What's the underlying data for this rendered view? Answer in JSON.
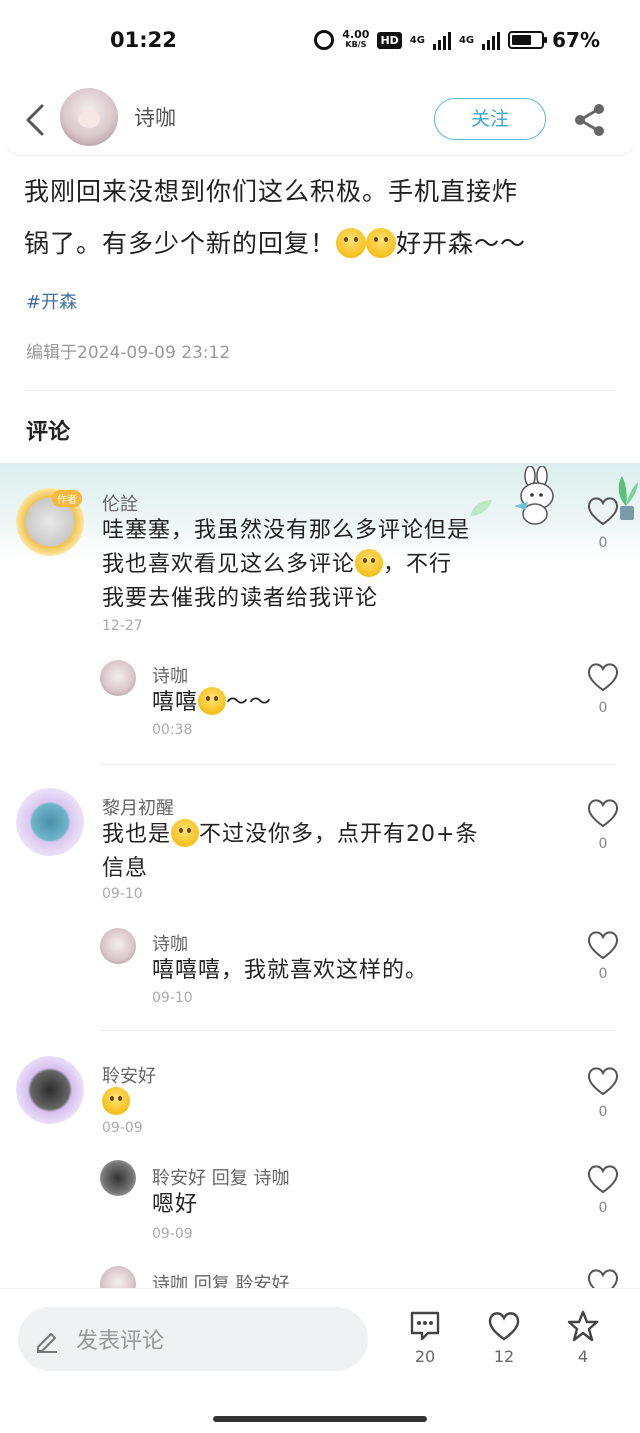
{
  "status_bar": {
    "time": "01:22",
    "net_speed_value": "4.00",
    "net_speed_unit": "KB/S",
    "hd_label": "HD",
    "signal1_label": "4G",
    "signal2_label": "4G",
    "battery_percent": "67%",
    "battery_level": 0.67
  },
  "header": {
    "author_name": "诗咖",
    "follow_label": "关注"
  },
  "post": {
    "text_line1": "我刚回来没想到你们这么积极。手机直接炸",
    "text_line2_a": "锅了。有多少个新的回复！",
    "text_line2_b": "好开森～～",
    "hashtag": "#开森",
    "edit_time": "编辑于2024-09-09 23:12"
  },
  "comments_section": {
    "title": "评论"
  },
  "comments": [
    {
      "name": "伦詮",
      "badge": "作者",
      "line1": "哇塞塞，我虽然没有那么多评论但是",
      "line2a": "我也喜欢看见这么多评论",
      "line2b": "，不行",
      "line3": "我要去催我的读者给我评论",
      "time": "12-27",
      "likes": "0",
      "reply": {
        "name": "诗咖",
        "text_a": "嘻嘻",
        "text_b": "～～",
        "time": "00:38",
        "likes": "0"
      }
    },
    {
      "name": "黎月初醒",
      "line1a": "我也是",
      "line1b": "不过没你多，点开有20+条",
      "line2": "信息",
      "time": "09-10",
      "likes": "0",
      "reply": {
        "name": "诗咖",
        "text": "嘻嘻嘻，我就喜欢这样的。",
        "time": "09-10",
        "likes": "0"
      }
    },
    {
      "name": "聆安好",
      "time": "09-09",
      "likes": "0",
      "reply": {
        "name": "聆安好 回复 诗咖",
        "text": "嗯好",
        "time": "09-09",
        "likes": "0"
      },
      "reply2": {
        "name": "诗咖 回复 聆安好"
      }
    }
  ],
  "bottom_bar": {
    "input_placeholder": "发表评论",
    "comment_count": "20",
    "like_count": "12",
    "favorite_count": "4"
  },
  "icons": {
    "back": "back-arrow-icon",
    "share": "share-icon",
    "like": "heart-icon",
    "comment": "comment-bubble-icon",
    "favorite": "star-icon",
    "edit": "pencil-icon"
  },
  "colors": {
    "accent": "#3aa6c9",
    "hashtag": "#3d6fa3",
    "author_badge": "#f6b93b"
  }
}
